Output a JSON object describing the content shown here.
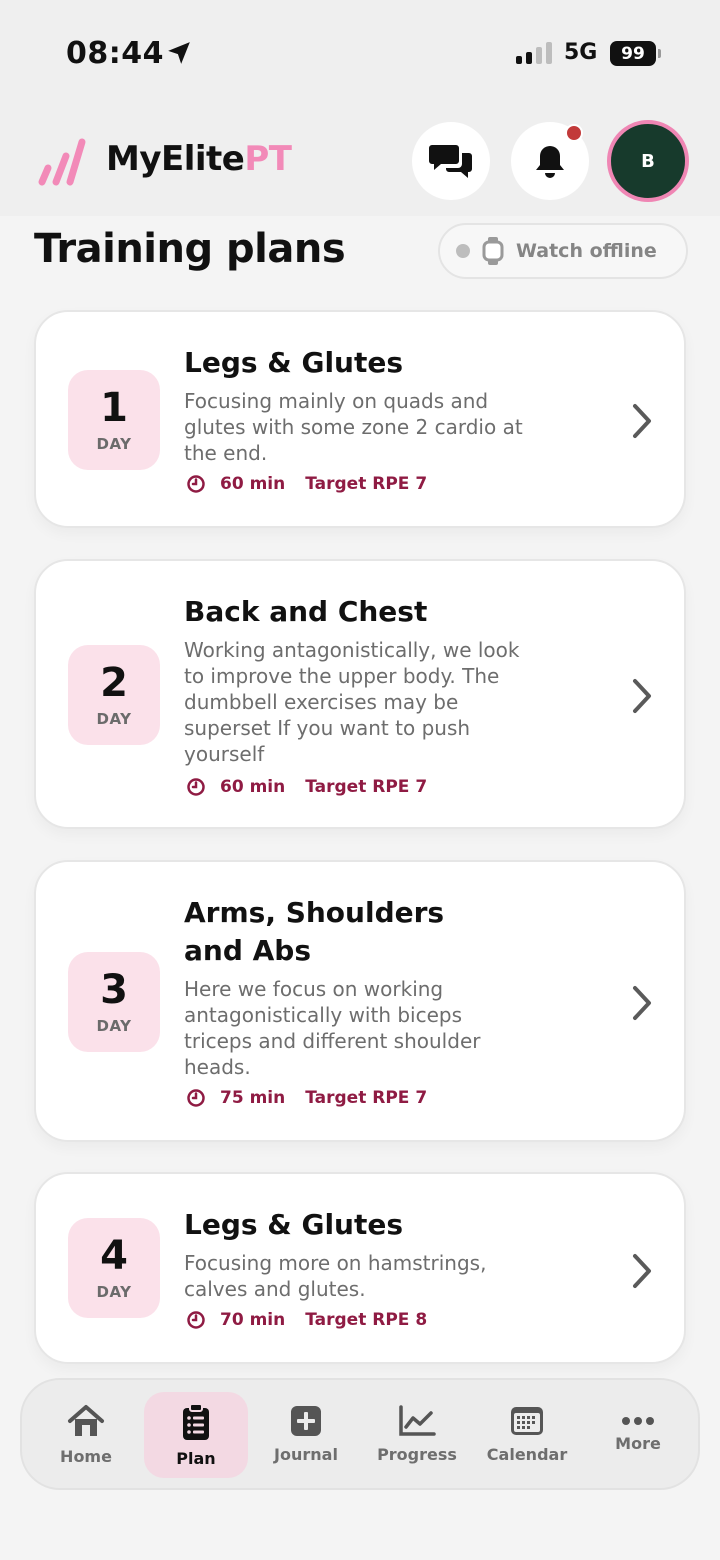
{
  "status_bar": {
    "time": "08:44",
    "network": "5G",
    "battery": "99"
  },
  "header": {
    "brand_part1": "MyElite",
    "brand_part2": "PT",
    "avatar_initial": "B"
  },
  "page": {
    "title": "Training plans",
    "watch_status": "Watch offline"
  },
  "colors": {
    "brand_pink": "#f28ab8",
    "accent_maroon": "#8f1b43",
    "day_badge_bg": "#fbe1ea",
    "avatar_bg": "#173a2c",
    "notification_dot": "#c23a3a"
  },
  "plans": [
    {
      "day": "1",
      "day_label": "DAY",
      "title": "Legs & Glutes",
      "desc": [
        "Focusing mainly on quads and",
        "glutes with some zone 2 cardio at",
        "the end."
      ],
      "duration": "60 min",
      "rpe": "Target RPE 7"
    },
    {
      "day": "2",
      "day_label": "DAY",
      "title": "Back and Chest",
      "desc": [
        "Working antagonistically, we look",
        "to improve the upper body. The",
        "dumbbell exercises may be",
        "superset If you want to push",
        "yourself"
      ],
      "duration": "60 min",
      "rpe": "Target RPE 7"
    },
    {
      "day": "3",
      "day_label": "DAY",
      "title": [
        "Arms, Shoulders",
        "and Abs"
      ],
      "desc": [
        "Here we focus on working",
        "antagonistically with biceps",
        "triceps and different shoulder",
        "heads."
      ],
      "duration": "75 min",
      "rpe": "Target RPE 7"
    },
    {
      "day": "4",
      "day_label": "DAY",
      "title": "Legs & Glutes",
      "desc": [
        "Focusing more on hamstrings,",
        "calves and glutes."
      ],
      "duration": "70 min",
      "rpe": "Target RPE 8"
    }
  ],
  "nav": {
    "home": "Home",
    "plan": "Plan",
    "journal": "Journal",
    "progress": "Progress",
    "calendar": "Calendar",
    "more": "More",
    "active": "plan"
  },
  "icons": [
    "location-arrow-icon",
    "signal-icon",
    "chat-icon",
    "bell-icon",
    "watch-icon",
    "clock-icon",
    "chevron-right-icon",
    "home-icon",
    "clipboard-icon",
    "journal-plus-icon",
    "progress-chart-icon",
    "calendar-icon",
    "more-dots-icon"
  ]
}
